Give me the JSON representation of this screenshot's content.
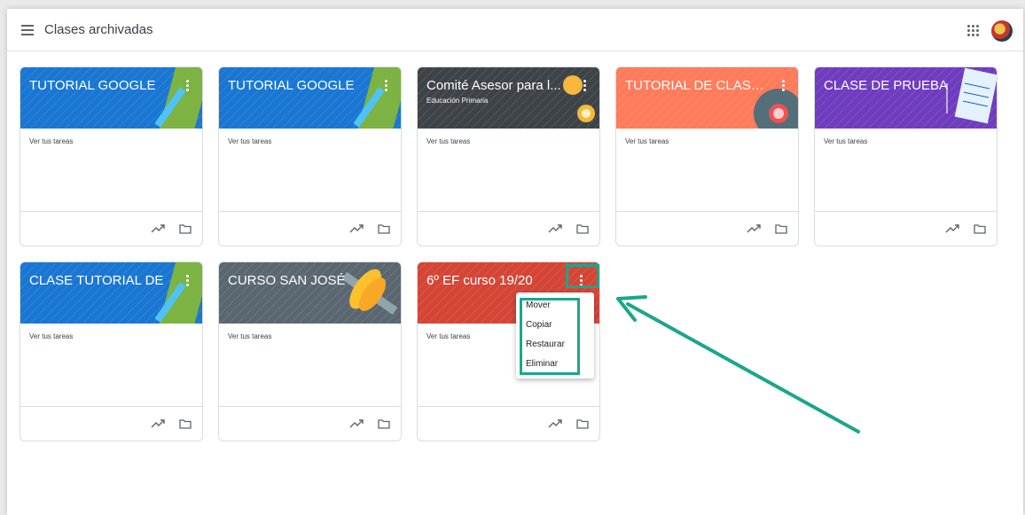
{
  "header": {
    "title": "Clases archivadas"
  },
  "colors": {
    "blue": "#1976d2",
    "dark": "#3d4347",
    "orange": "#ff7b5a",
    "purple": "#6f3cbf",
    "slate": "#5b6770",
    "red": "#d44536",
    "highlight": "#1ba68c"
  },
  "cards": [
    {
      "title": "TUTORIAL GOOGLE",
      "subtitle": "",
      "link": "Ver tus tareas",
      "theme": "blue"
    },
    {
      "title": "TUTORIAL GOOGLE",
      "subtitle": "",
      "link": "Ver tus tareas",
      "theme": "blue"
    },
    {
      "title": "Comité Asesor para l...",
      "subtitle": "Educación Primaria",
      "link": "Ver tus tareas",
      "theme": "dark"
    },
    {
      "title": "TUTORIAL DE CLASS...",
      "subtitle": "",
      "link": "Ver tus tareas",
      "theme": "orange"
    },
    {
      "title": "CLASE DE PRUEBA",
      "subtitle": "",
      "link": "Ver tus tareas",
      "theme": "purple"
    },
    {
      "title": "CLASE TUTORIAL DE",
      "subtitle": "",
      "link": "Ver tus tareas",
      "theme": "blue"
    },
    {
      "title": "CURSO SAN JOSÉ",
      "subtitle": "",
      "link": "Ver tus tareas",
      "theme": "slate"
    },
    {
      "title": "6º EF curso 19/20",
      "subtitle": "",
      "link": "Ver tus tareas",
      "theme": "red"
    }
  ],
  "menu": {
    "items": [
      "Mover",
      "Copiar",
      "Restaurar",
      "Eliminar"
    ]
  },
  "icons": {
    "menu": "hamburger-icon",
    "apps": "apps-grid-icon",
    "more": "more-vert-icon",
    "trend": "trending-up-icon",
    "folder": "folder-icon"
  }
}
